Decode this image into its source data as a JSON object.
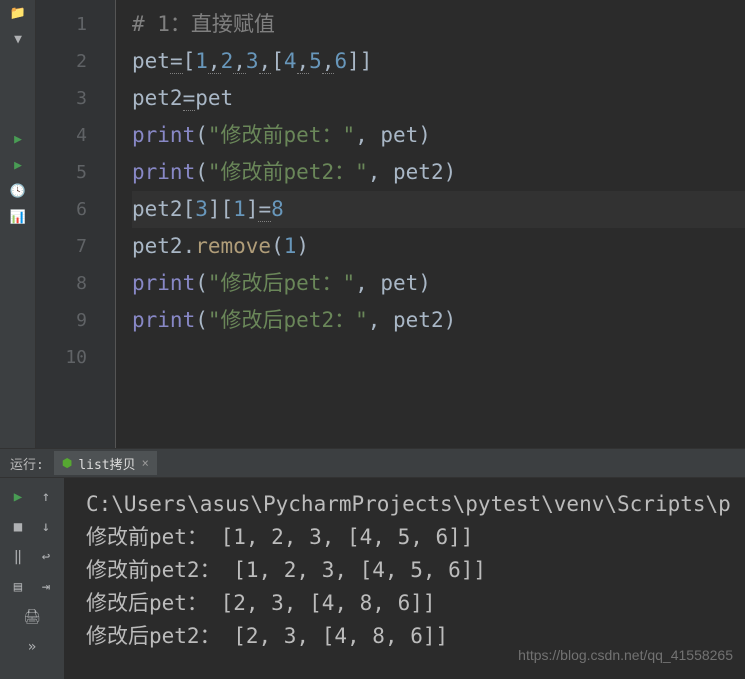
{
  "editor": {
    "lines": [
      {
        "n": "1",
        "tokens": [
          {
            "t": "# 1：直接赋值",
            "c": "tk-comment"
          }
        ]
      },
      {
        "n": "2",
        "tokens": [
          {
            "t": "pet",
            "c": "tk-punct"
          },
          {
            "t": "=",
            "c": "tk-punct tk-wavy"
          },
          {
            "t": "[",
            "c": "tk-punct"
          },
          {
            "t": "1",
            "c": "tk-number"
          },
          {
            "t": ",",
            "c": "tk-punct tk-wavy"
          },
          {
            "t": "2",
            "c": "tk-number"
          },
          {
            "t": ",",
            "c": "tk-punct tk-wavy"
          },
          {
            "t": "3",
            "c": "tk-number"
          },
          {
            "t": ",",
            "c": "tk-punct tk-wavy"
          },
          {
            "t": "[",
            "c": "tk-punct"
          },
          {
            "t": "4",
            "c": "tk-number"
          },
          {
            "t": ",",
            "c": "tk-punct tk-wavy"
          },
          {
            "t": "5",
            "c": "tk-number"
          },
          {
            "t": ",",
            "c": "tk-punct tk-wavy"
          },
          {
            "t": "6",
            "c": "tk-number"
          },
          {
            "t": "]]",
            "c": "tk-punct"
          }
        ]
      },
      {
        "n": "3",
        "tokens": [
          {
            "t": "pet2",
            "c": "tk-punct"
          },
          {
            "t": "=",
            "c": "tk-punct tk-wavy"
          },
          {
            "t": "pet",
            "c": "tk-punct"
          }
        ]
      },
      {
        "n": "4",
        "tokens": [
          {
            "t": "print",
            "c": "tk-builtin"
          },
          {
            "t": "(",
            "c": "tk-punct"
          },
          {
            "t": "\"修改前pet：\"",
            "c": "tk-string"
          },
          {
            "t": ", pet)",
            "c": "tk-punct"
          }
        ]
      },
      {
        "n": "5",
        "tokens": [
          {
            "t": "print",
            "c": "tk-builtin"
          },
          {
            "t": "(",
            "c": "tk-punct"
          },
          {
            "t": "\"修改前pet2：\"",
            "c": "tk-string"
          },
          {
            "t": ", pet2)",
            "c": "tk-punct"
          }
        ]
      },
      {
        "n": "6",
        "current": true,
        "tokens": [
          {
            "t": "pet2[",
            "c": "tk-punct"
          },
          {
            "t": "3",
            "c": "tk-number"
          },
          {
            "t": "][",
            "c": "tk-punct"
          },
          {
            "t": "1",
            "c": "tk-number"
          },
          {
            "t": "]",
            "c": "tk-punct"
          },
          {
            "t": "=",
            "c": "tk-punct tk-wavy"
          },
          {
            "t": "8",
            "c": "tk-number"
          }
        ]
      },
      {
        "n": "7",
        "tokens": [
          {
            "t": "pet2.",
            "c": "tk-punct"
          },
          {
            "t": "remove",
            "c": "tk-fn"
          },
          {
            "t": "(",
            "c": "tk-punct"
          },
          {
            "t": "1",
            "c": "tk-number"
          },
          {
            "t": ")",
            "c": "tk-punct"
          }
        ]
      },
      {
        "n": "8",
        "tokens": [
          {
            "t": "print",
            "c": "tk-builtin"
          },
          {
            "t": "(",
            "c": "tk-punct"
          },
          {
            "t": "\"修改后pet：\"",
            "c": "tk-string"
          },
          {
            "t": ", pet)",
            "c": "tk-punct"
          }
        ]
      },
      {
        "n": "9",
        "tokens": [
          {
            "t": "print",
            "c": "tk-builtin"
          },
          {
            "t": "(",
            "c": "tk-punct"
          },
          {
            "t": "\"修改后pet2：\"",
            "c": "tk-string"
          },
          {
            "t": ", pet2)",
            "c": "tk-punct"
          }
        ]
      },
      {
        "n": "10",
        "tokens": []
      }
    ]
  },
  "run": {
    "label": "运行:",
    "tab_name": "list拷贝",
    "close_x": "×",
    "output_lines": [
      "C:\\Users\\asus\\PycharmProjects\\pytest\\venv\\Scripts\\p",
      "修改前pet： [1, 2, 3, [4, 5, 6]]",
      "修改前pet2： [1, 2, 3, [4, 5, 6]]",
      "修改后pet： [2, 3, [4, 8, 6]]",
      "修改后pet2： [2, 3, [4, 8, 6]]"
    ]
  },
  "watermark": "https://blog.csdn.net/qq_41558265",
  "icons": {
    "folder": "📁",
    "chevron_down": "▼",
    "play": "▶",
    "struct": "▤",
    "chart": "📊",
    "clock": "🕓",
    "up": "↑",
    "down": "↓",
    "pause": "‖",
    "wrap": "↩",
    "step": "⇥",
    "save": "💾",
    "print": "🖨",
    "more": "»"
  }
}
